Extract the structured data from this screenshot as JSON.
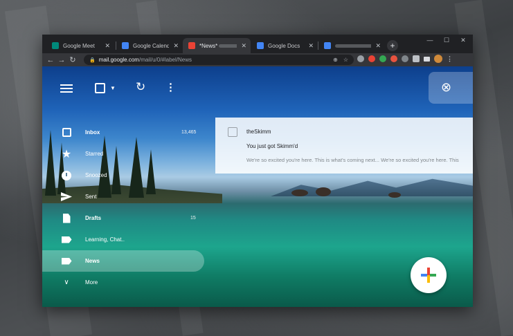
{
  "browser": {
    "tabs": [
      {
        "title": "Google Meet",
        "favicon_color": "#00897b"
      },
      {
        "title": "Google Calendar - V",
        "favicon_color": "#4285f4"
      },
      {
        "title": "*News*",
        "favicon_color": "#ea4335"
      },
      {
        "title": "Google Docs",
        "favicon_color": "#4285f4"
      },
      {
        "title": "",
        "favicon_color": "#4285f4"
      }
    ],
    "new_tab_glyph": "+",
    "url_host": "mail.google.com",
    "url_path": "/mail/u/0/#label/News"
  },
  "gmail": {
    "nav_items": [
      {
        "label": "Inbox",
        "count": "13,465",
        "icon": "inbox-icon"
      },
      {
        "label": "Starred",
        "count": "",
        "icon": "star-icon"
      },
      {
        "label": "Snoozed",
        "count": "",
        "icon": "clock-icon"
      },
      {
        "label": "Sent",
        "count": "",
        "icon": "send-icon"
      },
      {
        "label": "Drafts",
        "count": "15",
        "icon": "draft-icon"
      },
      {
        "label": "Learning, Chat..",
        "count": "",
        "icon": "label-icon"
      },
      {
        "label": "News",
        "count": "",
        "icon": "label-icon"
      },
      {
        "label": "More",
        "count": "",
        "icon": "chevron-down-icon"
      }
    ],
    "email": {
      "sender": "theSkimm",
      "subject": "You just got Skimm'd",
      "snippet": "We're so excited you're here. This is what's coming next... We're so excited you're here. This"
    }
  },
  "colors": {
    "accent_blue": "#4285f4",
    "accent_red": "#ea4335",
    "accent_yellow": "#fbbc04",
    "accent_green": "#34a853"
  }
}
